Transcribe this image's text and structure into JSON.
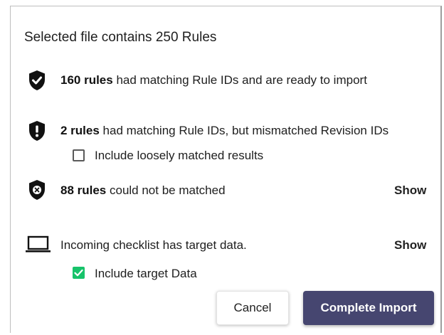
{
  "dialog": {
    "title": "Selected file contains 250 Rules",
    "matched": {
      "icon": "shield-check-icon",
      "count": "160 rules",
      "text": " had matching Rule IDs and are ready to import"
    },
    "mismatched": {
      "icon": "shield-exclamation-icon",
      "count": "2 rules",
      "text": " had matching Rule IDs, but mismatched Revision IDs",
      "checkbox_label": "Include loosely matched results",
      "checkbox_checked": false
    },
    "unmatched": {
      "icon": "shield-x-icon",
      "count": "88 rules",
      "text": " could not be matched",
      "show_label": "Show"
    },
    "target": {
      "icon": "laptop-icon",
      "text": "Incoming checklist has target data.",
      "show_label": "Show",
      "checkbox_label": "Include target Data",
      "checkbox_checked": true
    },
    "buttons": {
      "cancel": "Cancel",
      "complete": "Complete Import"
    }
  },
  "colors": {
    "primary_button": "#464670",
    "checkbox_checked": "#17c36a"
  }
}
